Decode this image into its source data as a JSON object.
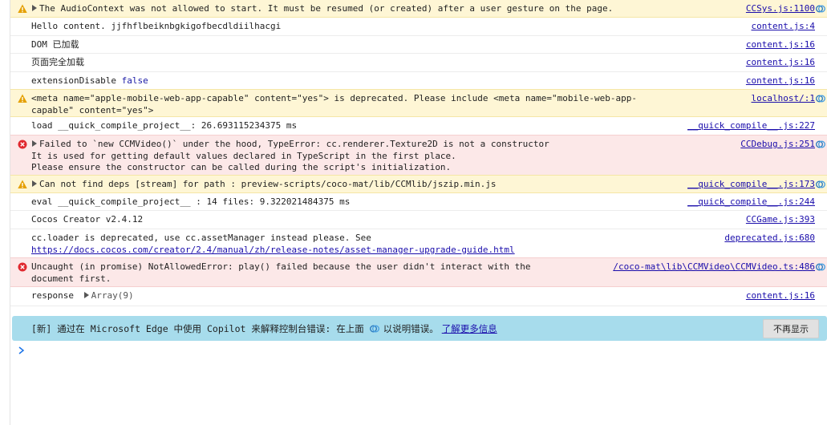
{
  "console": {
    "rows": [
      {
        "level": "warn",
        "expand": true,
        "text": "The AudioContext was not allowed to start. It must be resumed (or created) after a user gesture on the page.",
        "source": "CCSys.js:1100",
        "copilot": true
      },
      {
        "level": "log",
        "text": "Hello content. jjfhflbeiknbgkigofbecdldiilhacgi",
        "source": "content.js:4"
      },
      {
        "level": "log",
        "text": "DOM 已加载",
        "source": "content.js:16"
      },
      {
        "level": "log",
        "text": "页面完全加载",
        "source": "content.js:16"
      },
      {
        "level": "log",
        "text": "extensionDisable",
        "value": "false",
        "source": "content.js:16"
      },
      {
        "level": "warn",
        "text": "<meta name=\"apple-mobile-web-app-capable\" content=\"yes\"> is deprecated. Please include <meta name=\"mobile-web-app-capable\" content=\"yes\">",
        "source": "localhost/:1",
        "copilot": true
      },
      {
        "level": "log",
        "text": "load __quick_compile_project__: 26.693115234375 ms",
        "source": "__quick_compile__.js:227"
      },
      {
        "level": "error",
        "expand": true,
        "text": "Failed to `new CCMVideo()` under the hood, TypeError: cc.renderer.Texture2D is not a constructor\nIt is used for getting default values declared in TypeScript in the first place.\nPlease ensure the constructor can be called during the script's initialization.",
        "source": "CCDebug.js:251",
        "copilot": true
      },
      {
        "level": "warn",
        "expand": true,
        "text": "Can not find deps [stream] for path : preview-scripts/coco-mat/lib/CCMlib/jszip.min.js",
        "source": "__quick_compile__.js:173",
        "copilot": true
      },
      {
        "level": "log",
        "text": "eval __quick_compile_project__ : 14 files: 9.322021484375 ms",
        "source": "__quick_compile__.js:244"
      },
      {
        "level": "log",
        "text": "Cocos Creator v2.4.12",
        "source": "CCGame.js:393"
      },
      {
        "level": "log",
        "text": "cc.loader is deprecated, use cc.assetManager instead please. See",
        "link": "https://docs.cocos.com/creator/2.4/manual/zh/release-notes/asset-manager-upgrade-guide.html",
        "source": "deprecated.js:680"
      },
      {
        "level": "error",
        "text": "Uncaught (in promise) NotAllowedError: play() failed because the user didn't interact with the document first.",
        "source": "/coco-mat\\lib\\CCMVideo\\CCMVideo.ts:486",
        "copilot": true
      },
      {
        "level": "log",
        "text": "response",
        "object": "Array(9)",
        "source": "content.js:16"
      }
    ]
  },
  "banner": {
    "text_before": "[新] 通过在 Microsoft Edge 中使用 Copilot 来解释控制台错误: 在上面",
    "text_after": "以说明错误。",
    "link": "了解更多信息",
    "dismiss": "不再显示"
  },
  "colors": {
    "warn_bg": "#fef6d5",
    "error_bg": "#fce8e8",
    "banner_bg": "#a7dcec",
    "link": "#1a0dab"
  }
}
